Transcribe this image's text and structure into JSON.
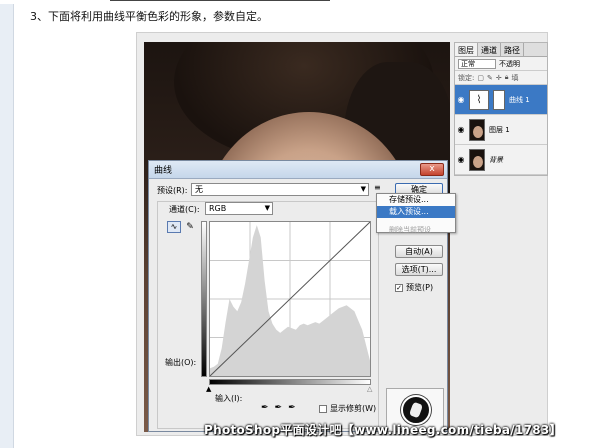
{
  "article": {
    "step_text": "3、下面将利用曲线平衡色彩的形象，参数自定。"
  },
  "layers_panel": {
    "tabs": [
      "图层",
      "通道",
      "路径"
    ],
    "blend_mode": "正常",
    "opacity_label": "不透明",
    "lock_label": "锁定:",
    "fill_label": "填",
    "layers": [
      {
        "name": "曲线 1",
        "type": "adjustment",
        "active": true
      },
      {
        "name": "图层 1",
        "type": "image",
        "active": false
      },
      {
        "name": "背景",
        "type": "image",
        "active": false
      }
    ]
  },
  "curves_dialog": {
    "title": "曲线",
    "close_label": "x",
    "preset_label": "预设(R):",
    "preset_value": "无",
    "preset_menu_icon": "≡",
    "channel_label": "通道(C):",
    "channel_value": "RGB",
    "output_label": "输出(O):",
    "input_label": "输入(I):",
    "show_clipping_label": "显示修剪(W)",
    "buttons": {
      "ok": "确定",
      "auto": "自动(A)",
      "options": "选项(T)..."
    },
    "preview_label": "预览(P)",
    "preview_checked": true
  },
  "context_menu": {
    "items": [
      {
        "label": "存储预设...",
        "highlighted": false
      },
      {
        "label": "载入预设...",
        "highlighted": true
      }
    ],
    "disabled_item": "删除当前预设"
  },
  "histogram": [
    0.05,
    0.06,
    0.08,
    0.18,
    0.35,
    0.5,
    0.45,
    0.42,
    0.48,
    0.6,
    0.75,
    0.9,
    0.98,
    0.9,
    0.62,
    0.42,
    0.34,
    0.3,
    0.28,
    0.3,
    0.32,
    0.31,
    0.3,
    0.33,
    0.34,
    0.33,
    0.34,
    0.35,
    0.34,
    0.36,
    0.38,
    0.4,
    0.42,
    0.44,
    0.45,
    0.46,
    0.44,
    0.42,
    0.36,
    0.3,
    0.2,
    0.1
  ],
  "watermark": "PhotoShop平面设计吧【www.lineeg.com/tieba/1783】",
  "colors": {
    "accent": "#3b79c5",
    "dialog_bg": "#ececec",
    "histogram_fill": "#d4d4d4"
  }
}
